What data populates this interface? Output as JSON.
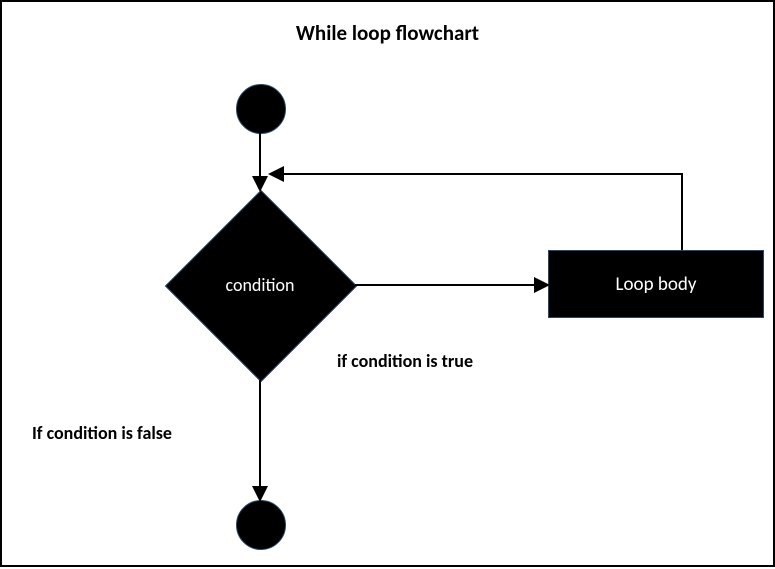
{
  "title": "While loop flowchart",
  "nodes": {
    "condition": "condition",
    "loop_body": "Loop body"
  },
  "labels": {
    "true_branch": "if condition is true",
    "false_branch": "If condition is false"
  }
}
